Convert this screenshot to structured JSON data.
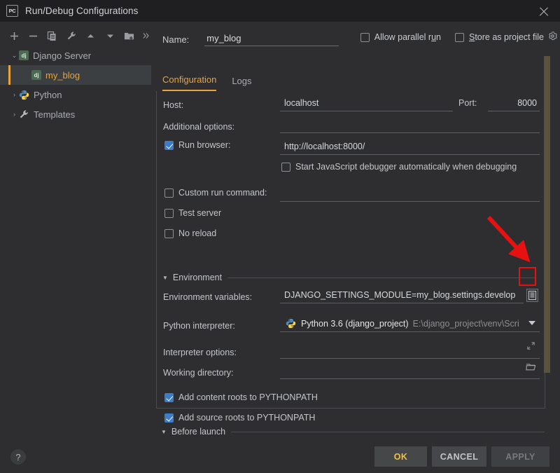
{
  "window": {
    "title": "Run/Debug Configurations",
    "logo_text": "PC",
    "close_icon": "close-icon"
  },
  "toolbar": {
    "items": [
      {
        "name": "add-configuration-button",
        "icon": "plus-icon"
      },
      {
        "name": "remove-configuration-button",
        "icon": "minus-icon"
      },
      {
        "name": "copy-configuration-button",
        "icon": "copy-icon"
      },
      {
        "name": "edit-templates-button",
        "icon": "wrench-icon"
      },
      {
        "name": "move-up-button",
        "icon": "arrow-up-icon"
      },
      {
        "name": "move-down-button",
        "icon": "arrow-down-icon"
      },
      {
        "name": "create-folder-button",
        "icon": "folder-add-icon"
      },
      {
        "name": "more-options-button",
        "icon": "chevron-double-right-icon"
      }
    ]
  },
  "tree": {
    "items": [
      {
        "label": "Django Server",
        "icon": "django-icon",
        "expanded": true,
        "arrow": "⌄",
        "selected": false,
        "child": false
      },
      {
        "label": "my_blog",
        "icon": "django-icon",
        "expanded": false,
        "arrow": "",
        "selected": true,
        "child": true
      },
      {
        "label": "Python",
        "icon": "python-icon",
        "expanded": false,
        "arrow": "›",
        "selected": false,
        "child": false
      },
      {
        "label": "Templates",
        "icon": "wrench-icon",
        "expanded": false,
        "arrow": "›",
        "selected": false,
        "child": false
      }
    ]
  },
  "header": {
    "name_label": "Name:",
    "name_value": "my_blog",
    "allow_parallel_run": {
      "label_pre": "Allow parallel r",
      "label_mnem": "u",
      "label_post": "n",
      "checked": false
    },
    "store_as_project_file": {
      "label_mnem": "S",
      "label_post": "tore as project file",
      "checked": false
    },
    "gear_icon": "gear-icon"
  },
  "tabs": [
    {
      "label": "Configuration",
      "active": true
    },
    {
      "label": "Logs",
      "active": false
    }
  ],
  "form": {
    "host_label": "Host:",
    "host_value": "localhost",
    "port_label": "Port:",
    "port_value": "8000",
    "additional_options_label": "Additional options:",
    "additional_options_value": "",
    "run_browser": {
      "label": "Run browser:",
      "checked": true,
      "value": "http://localhost:8000/"
    },
    "start_js_debugger": {
      "label": "Start JavaScript debugger automatically when debugging",
      "checked": false
    },
    "custom_run_command": {
      "label": "Custom run command:",
      "checked": false,
      "value": ""
    },
    "test_server": {
      "label": "Test server",
      "checked": false
    },
    "no_reload": {
      "label": "No reload",
      "checked": false
    },
    "environment_group_label": "Environment",
    "env_vars_label": "Environment variables:",
    "env_vars_value": "DJANGO_SETTINGS_MODULE=my_blog.settings.develop",
    "env_vars_button_icon": "edit-env-vars-icon",
    "interpreter_label": "Python interpreter:",
    "interpreter_icon": "python-icon",
    "interpreter_name": "Python 3.6 (django_project)",
    "interpreter_path": "E:\\django_project\\venv\\Scri",
    "interpreter_options_label": "Interpreter options:",
    "interpreter_options_value": "",
    "working_directory_label": "Working directory:",
    "working_directory_value": "",
    "add_content_roots": {
      "label": "Add content roots to PYTHONPATH",
      "checked": true
    },
    "add_source_roots": {
      "label": "Add source roots to PYTHONPATH",
      "checked": true
    }
  },
  "before_launch": {
    "label": "Before launch",
    "expanded": true
  },
  "footer": {
    "help_label": "?",
    "ok_label": "OK",
    "cancel_label": "CANCEL",
    "apply_label": "APPLY"
  },
  "annotation": {
    "arrow_color": "#e81111",
    "highlight_color": "#e81111",
    "target": "env-vars-editor-button"
  },
  "colors": {
    "accent": "#e8a33d",
    "checkbox_checked": "#3d7cc9",
    "window_bg": "#2e2e30",
    "titlebar_bg": "#1f1f21",
    "scrollbar": "#5a523d"
  }
}
